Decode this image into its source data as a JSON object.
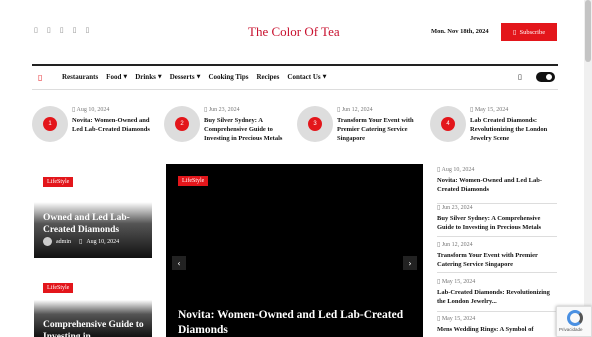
{
  "header": {
    "social_icons": [
      "facebook-icon",
      "twitter-icon",
      "instagram-icon",
      "pinterest-icon",
      "youtube-icon"
    ],
    "social_glyph": "▯",
    "logo_text": "The Color Of Tea",
    "date": "Mon. Nov 18th, 2024",
    "subscribe_icon": "▯",
    "subscribe_label": "Subscribe"
  },
  "nav": {
    "home_icon": "▯",
    "items": [
      {
        "label": "Restaurants",
        "caret": ""
      },
      {
        "label": "Food",
        "caret": "▼"
      },
      {
        "label": "Drinks",
        "caret": "▼"
      },
      {
        "label": "Desserts",
        "caret": "▼"
      },
      {
        "label": "Cooking Tips",
        "caret": ""
      },
      {
        "label": "Recipes",
        "caret": ""
      },
      {
        "label": "Contact Us",
        "caret": "▼"
      }
    ],
    "search_icon": "▯"
  },
  "trending": [
    {
      "num": "1",
      "date": "Aug 10, 2024",
      "title": "Novita: Women-Owned and Led Lab-Created Diamonds"
    },
    {
      "num": "2",
      "date": "Jun 23, 2024",
      "title": "Buy Silver Sydney: A Comprehensive Guide to Investing in Precious Metals"
    },
    {
      "num": "3",
      "date": "Jun 12, 2024",
      "title": "Transform Your Event with Premier Catering Service Singapore"
    },
    {
      "num": "4",
      "date": "May 15, 2024",
      "title": "Lab Created Diamonds: Revolutionizing the London Jewelry Scene"
    }
  ],
  "date_icon": "▯",
  "left_cards": [
    {
      "badge": "LifeStyle",
      "title": "Owned and Led Lab-Created Diamonds",
      "author": "admin",
      "date": "Aug 10, 2024"
    },
    {
      "badge": "LifeStyle",
      "title": "Comprehensive Guide to Investing in"
    }
  ],
  "hero": {
    "badge": "LifeStyle",
    "title": "Novita: Women-Owned and Led Lab-Created Diamonds",
    "prev_icon": "‹",
    "next_icon": "›"
  },
  "sidebar": [
    {
      "date": "Aug 10, 2024",
      "title": "Novita: Women-Owned and Led Lab-Created Diamonds"
    },
    {
      "date": "Jun 23, 2024",
      "title": "Buy Silver Sydney: A Comprehensive Guide to Investing in Precious Metals"
    },
    {
      "date": "Jun 12, 2024",
      "title": "Transform Your Event with Premier Catering Service Singapore"
    },
    {
      "date": "May 15, 2024",
      "title": "Lab-Created Diamonds: Revolutionizing the London Jewelry..."
    },
    {
      "date": "May 15, 2024",
      "title": "Mens Wedding Rings: A Symbol of"
    }
  ],
  "recaptcha": {
    "label": "Privacidade"
  },
  "colors": {
    "accent": "#e3161b",
    "dark": "#111111"
  }
}
